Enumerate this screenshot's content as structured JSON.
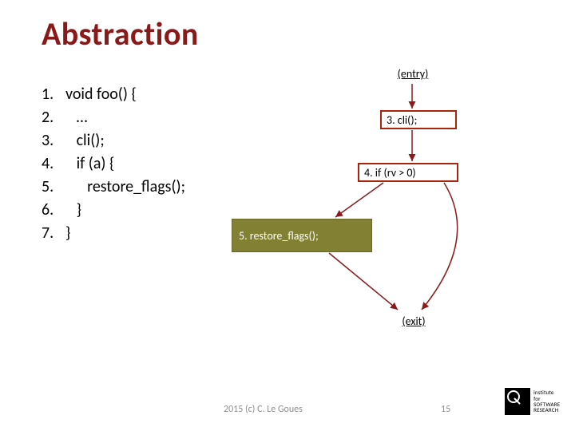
{
  "title": "Abstraction",
  "code": {
    "lines": [
      {
        "n": "1.",
        "text": "void foo() {"
      },
      {
        "n": "2.",
        "text": "   …"
      },
      {
        "n": "3.",
        "text": "   cli();"
      },
      {
        "n": "4.",
        "text": "   if (a) {"
      },
      {
        "n": "5.",
        "text": "      restore_flags();"
      },
      {
        "n": "6.",
        "text": "   }"
      },
      {
        "n": "7.",
        "text": "}"
      }
    ]
  },
  "graph": {
    "entry": "(entry)",
    "node3": "3.   cli();",
    "node4": "4.   if (rv > 0)",
    "node5": "5.  restore_flags();",
    "exit": "(exit)"
  },
  "footer": {
    "copyright": "2015 (c) C. Le Goues",
    "page": "15"
  },
  "logo": {
    "line1": "institute for",
    "line2": "SOFTWARE",
    "line3": "RESEARCH"
  },
  "colors": {
    "title": "#8a1a1a",
    "node_border": "#a8240b",
    "node5_bg": "#828033",
    "arrow": "#8a1a1a"
  }
}
